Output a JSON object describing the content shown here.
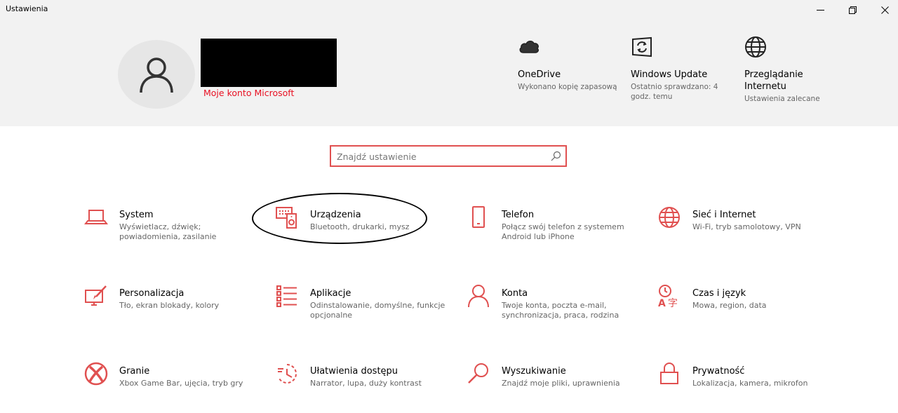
{
  "window": {
    "title": "Ustawienia"
  },
  "colors": {
    "accent": "#e81123",
    "icon": "#e05050",
    "header_bg": "#f2f2f2"
  },
  "account": {
    "link": "Moje konto Microsoft"
  },
  "quick": {
    "onedrive": {
      "title": "OneDrive",
      "sub": "Wykonano kopię zapasową"
    },
    "update": {
      "title": "Windows Update",
      "sub": "Ostatnio sprawdzano: 4 godz. temu"
    },
    "browse": {
      "title": "Przeglądanie Internetu",
      "sub": "Ustawienia zalecane"
    }
  },
  "search": {
    "placeholder": "Znajdź ustawienie"
  },
  "tiles": [
    {
      "name": "System",
      "desc": "Wyświetlacz, dźwięk; powiadomienia, zasilanie",
      "icon": "laptop-icon"
    },
    {
      "name": "Urządzenia",
      "desc": "Bluetooth, drukarki, mysz",
      "icon": "devices-icon"
    },
    {
      "name": "Telefon",
      "desc": "Połącz swój telefon z systemem Android lub iPhone",
      "icon": "phone-icon"
    },
    {
      "name": "Sieć i Internet",
      "desc": "Wi-Fi, tryb samolotowy, VPN",
      "icon": "globe-icon"
    },
    {
      "name": "Personalizacja",
      "desc": "Tło, ekran blokady, kolory",
      "icon": "paintbrush-icon"
    },
    {
      "name": "Aplikacje",
      "desc": "Odinstalowanie, domyślne, funkcje opcjonalne",
      "icon": "apps-list-icon"
    },
    {
      "name": "Konta",
      "desc": "Twoje konta, poczta e-mail, synchronizacja, praca, rodzina",
      "icon": "person-icon"
    },
    {
      "name": "Czas i język",
      "desc": "Mowa, region, data",
      "icon": "language-icon"
    },
    {
      "name": "Granie",
      "desc": "Xbox Game Bar, ujęcia, tryb gry",
      "icon": "xbox-icon"
    },
    {
      "name": "Ułatwienia dostępu",
      "desc": "Narrator, lupa, duży kontrast",
      "icon": "ease-of-access-icon"
    },
    {
      "name": "Wyszukiwanie",
      "desc": "Znajdź moje pliki, uprawnienia",
      "icon": "search-icon"
    },
    {
      "name": "Prywatność",
      "desc": "Lokalizacja, kamera, mikrofon",
      "icon": "lock-icon"
    }
  ]
}
